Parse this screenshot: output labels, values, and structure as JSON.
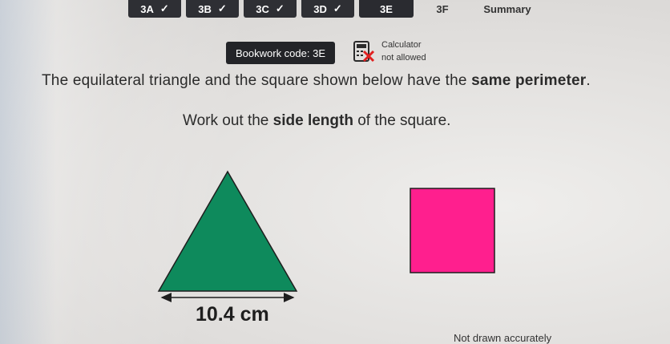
{
  "tabs": [
    {
      "label": "3A",
      "state": "done"
    },
    {
      "label": "3B",
      "state": "done"
    },
    {
      "label": "3C",
      "state": "done"
    },
    {
      "label": "3D",
      "state": "done"
    },
    {
      "label": "3E",
      "state": "current"
    },
    {
      "label": "3F",
      "state": "todo"
    },
    {
      "label": "Summary",
      "state": "todo"
    }
  ],
  "bookwork": {
    "label": "Bookwork code: 3E"
  },
  "calculator": {
    "line1": "Calculator",
    "line2": "not allowed",
    "icon": "calculator-not-allowed-icon"
  },
  "question": {
    "part1": "The equilateral triangle and the square shown below have the ",
    "bold1": "same perimeter",
    "part2": "."
  },
  "instruction": {
    "part1": "Work out the ",
    "bold1": "side length",
    "part2": " of the square."
  },
  "triangle": {
    "side_label": "10.4 cm",
    "fill": "#0e8a5c"
  },
  "square": {
    "fill": "#ff1f8e"
  },
  "note": "Not drawn accurately"
}
